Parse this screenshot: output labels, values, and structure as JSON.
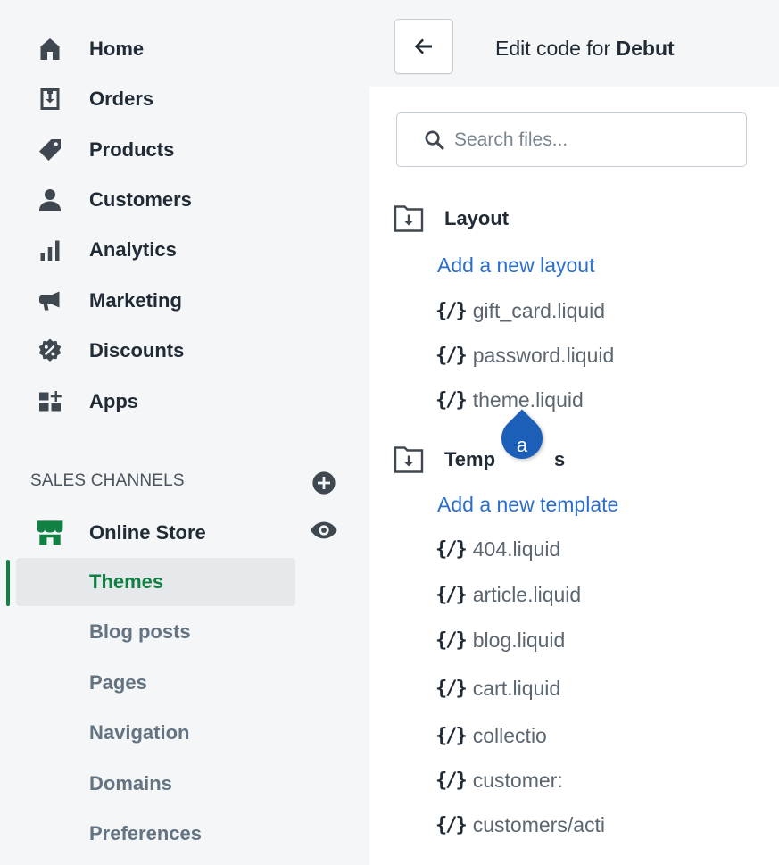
{
  "sidebar": {
    "items": [
      {
        "label": "Home",
        "icon": "home-icon"
      },
      {
        "label": "Orders",
        "icon": "orders-icon"
      },
      {
        "label": "Products",
        "icon": "tag-icon"
      },
      {
        "label": "Customers",
        "icon": "person-icon"
      },
      {
        "label": "Analytics",
        "icon": "bar-chart-icon"
      },
      {
        "label": "Marketing",
        "icon": "megaphone-icon"
      },
      {
        "label": "Discounts",
        "icon": "discount-badge-icon"
      },
      {
        "label": "Apps",
        "icon": "apps-grid-icon"
      }
    ],
    "sales_channels_heading": "SALES CHANNELS",
    "online_store": {
      "label": "Online Store",
      "subitems": [
        {
          "label": "Themes",
          "active": true
        },
        {
          "label": "Blog posts"
        },
        {
          "label": "Pages"
        },
        {
          "label": "Navigation"
        },
        {
          "label": "Domains"
        },
        {
          "label": "Preferences"
        }
      ]
    }
  },
  "editor": {
    "title_prefix": "Edit code for",
    "theme_name": "Debut",
    "search_placeholder": "Search files...",
    "code_glyph": "{/}",
    "layout": {
      "label": "Layout",
      "add_link": "Add a new layout",
      "files": [
        "gift_card.liquid",
        "password.liquid",
        "theme.liquid"
      ]
    },
    "templates": {
      "label": "Temp",
      "label_tail": "s",
      "add_link": "Add a new template",
      "files": [
        "404.liquid",
        "article.liquid",
        "blog.liquid",
        "cart.liquid",
        "collectio",
        "customer:",
        "customers/acti"
      ]
    }
  },
  "annotation": {
    "label": "a"
  },
  "colors": {
    "sidebar_bg": "#f4f6f8",
    "active_green": "#108043",
    "link_blue": "#2c6ecb",
    "marker_blue": "#1c5fb8"
  }
}
